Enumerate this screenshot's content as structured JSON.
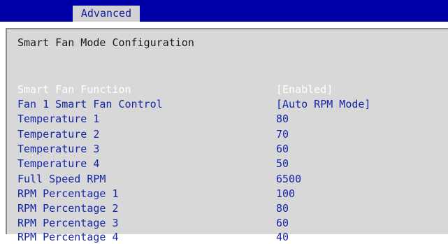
{
  "header": {
    "active_tab": "Advanced"
  },
  "section": {
    "title": "Smart Fan Mode Configuration"
  },
  "settings": [
    {
      "label": "Smart Fan Function",
      "value": "[Enabled]",
      "selected": true
    },
    {
      "label": "Fan 1 Smart Fan Control",
      "value": "[Auto RPM Mode]",
      "selected": false
    },
    {
      "label": "Temperature 1",
      "value": "80",
      "selected": false
    },
    {
      "label": "Temperature 2",
      "value": "70",
      "selected": false
    },
    {
      "label": "Temperature 3",
      "value": "60",
      "selected": false
    },
    {
      "label": "Temperature 4",
      "value": "50",
      "selected": false
    },
    {
      "label": "Full Speed RPM",
      "value": "6500",
      "selected": false
    },
    {
      "label": "RPM Percentage 1",
      "value": "100",
      "selected": false
    },
    {
      "label": "RPM Percentage 2",
      "value": "80",
      "selected": false
    },
    {
      "label": "RPM Percentage 3",
      "value": "60",
      "selected": false
    },
    {
      "label": "RPM Percentage 4",
      "value": "40",
      "selected": false
    }
  ],
  "colors": {
    "header_bg": "#0000a8",
    "panel_bg": "#d8d8d8",
    "item_text": "#1525a8",
    "selected_text": "#ffffff"
  }
}
